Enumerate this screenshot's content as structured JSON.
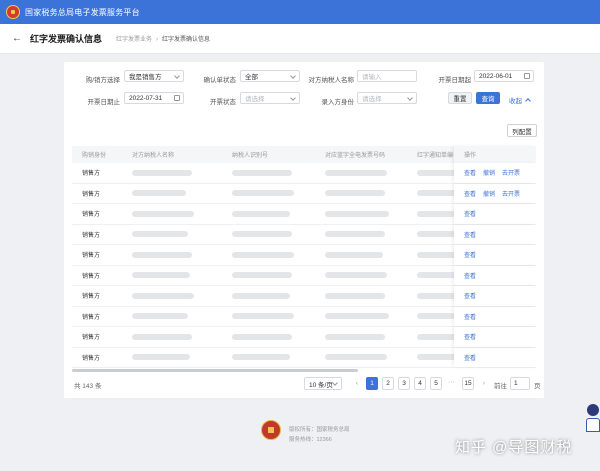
{
  "app": {
    "title": "国家税务总局电子发票服务平台"
  },
  "header": {
    "page_title": "红字发票确认信息",
    "breadcrumb": [
      "红字发票业务",
      "红字发票确认信息"
    ]
  },
  "filters": {
    "buyer_seller_label": "购/销方选择",
    "buyer_seller_value": "我是销售方",
    "confirm_status_label": "确认单状态",
    "confirm_status_value": "全部",
    "counterparty_name_label": "对方纳税人名称",
    "counterparty_name_placeholder": "请输入",
    "date_start_label": "开票日期起",
    "date_start_value": "2022-06-01",
    "date_end_label": "开票日期止",
    "date_end_value": "2022-07-31",
    "invoice_status_label": "开票状态",
    "invoice_status_placeholder": "请选择",
    "entry_party_label": "录入方身份",
    "entry_party_placeholder": "请选择",
    "reset_label": "重置",
    "search_label": "查询",
    "collapse_label": "收起"
  },
  "column_settings_label": "列配置",
  "table": {
    "headers": [
      "购销身份",
      "对方纳税人名称",
      "纳税人识别号",
      "对应蓝字全电发票号码",
      "红字通知单编号",
      "操作"
    ],
    "rows": [
      {
        "side": "销售方",
        "ops": [
          "查看",
          "撤销",
          "去开票"
        ]
      },
      {
        "side": "销售方",
        "ops": [
          "查看",
          "撤销",
          "去开票"
        ]
      },
      {
        "side": "销售方",
        "ops": [
          "查看"
        ]
      },
      {
        "side": "销售方",
        "ops": [
          "查看"
        ]
      },
      {
        "side": "销售方",
        "ops": [
          "查看"
        ]
      },
      {
        "side": "销售方",
        "ops": [
          "查看"
        ]
      },
      {
        "side": "销售方",
        "ops": [
          "查看"
        ]
      },
      {
        "side": "销售方",
        "ops": [
          "查看"
        ]
      },
      {
        "side": "销售方",
        "ops": [
          "查看"
        ]
      },
      {
        "side": "销售方",
        "ops": [
          "查看"
        ]
      }
    ]
  },
  "pagination": {
    "total": "共 143 条",
    "page_size": "10 条/页",
    "pages": [
      "1",
      "2",
      "3",
      "4",
      "5"
    ],
    "ellipsis": "···",
    "last_page": "15",
    "prev": "‹",
    "next": "›",
    "goto_label": "前往",
    "goto_value": "1",
    "goto_unit": "页",
    "current_page": "1"
  },
  "footer": {
    "owner": "版权所有：国家税务总局",
    "hotline": "服务热线：12366"
  },
  "watermark": "知乎 @导图财税",
  "colors": {
    "primary": "#3b73d8",
    "topbar": "#3b73d8"
  }
}
